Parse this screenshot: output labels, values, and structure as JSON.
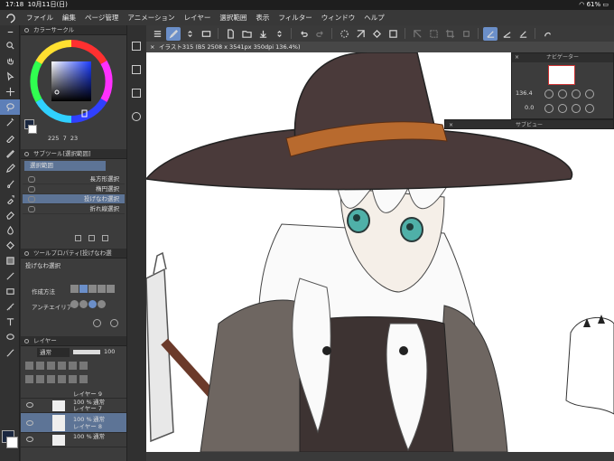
{
  "status": {
    "time": "17:18",
    "date": "10月11日(日)",
    "battery": "61%"
  },
  "menu": [
    "ファイル",
    "編集",
    "ページ管理",
    "アニメーション",
    "レイヤー",
    "選択範囲",
    "表示",
    "フィルター",
    "ウィンドウ",
    "ヘルプ"
  ],
  "canvas_tab": "イラスト315 (B5 2508 x 3541px 350dpi 136.4%)",
  "color_panel": {
    "title": "カラーサークル",
    "values": [
      "225",
      "7",
      "23"
    ],
    "main_color": "#1a2740",
    "sub_color": "#ffffff"
  },
  "subtool": {
    "title": "サブツール[選択範囲]",
    "group": "選択範囲",
    "items": [
      "長方形選択",
      "楕円選択",
      "投げなわ選択",
      "折れ線選択"
    ],
    "selected_index": 2
  },
  "tool_property": {
    "title": "ツールプロパティ[投げなわ選",
    "name": "投げなわ選択",
    "labels": [
      "作成方法",
      "アンチエイリア"
    ]
  },
  "layer_panel": {
    "title": "レイヤー",
    "blend": "通常",
    "opacity": "100",
    "layers": [
      {
        "percent": "",
        "mode": "",
        "name": "レイヤー 9"
      },
      {
        "percent": "100 %",
        "mode": "通常",
        "name": "レイヤー 7"
      },
      {
        "percent": "100 %",
        "mode": "通常",
        "name": "レイヤー 8"
      },
      {
        "percent": "100 %",
        "mode": "通常",
        "name": ""
      }
    ],
    "selected_index": 2
  },
  "navigator": {
    "title": "ナビゲーター",
    "zoom": "136.4",
    "rotation": "0.0"
  },
  "subview": {
    "title": "サブビュー"
  },
  "colors": {
    "accent": "#6b8fc9",
    "hat": "#4a3a3a",
    "hat_band": "#b86a2e",
    "eye": "#4fb0a8"
  }
}
